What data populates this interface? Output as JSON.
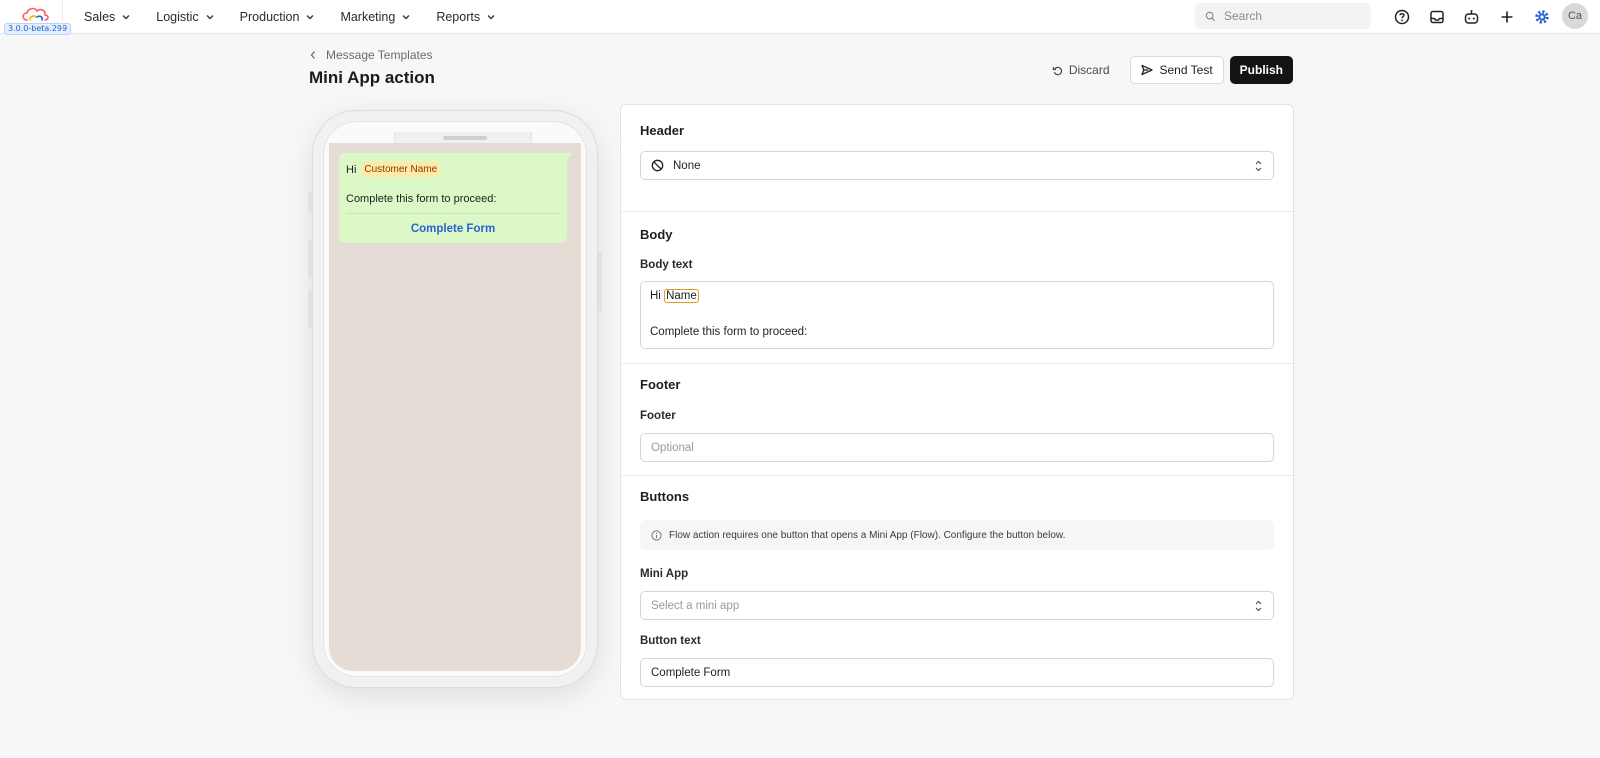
{
  "app": {
    "version": "3.0.0-beta.299",
    "brand_colors": [
      "#ff5a5f",
      "#ffb400",
      "#2a62d6"
    ]
  },
  "nav": {
    "items": [
      {
        "label": "Sales"
      },
      {
        "label": "Logistic"
      },
      {
        "label": "Production"
      },
      {
        "label": "Marketing"
      },
      {
        "label": "Reports"
      }
    ]
  },
  "search": {
    "placeholder": "Search"
  },
  "top_icons": [
    "help-icon",
    "inbox-icon",
    "bot-icon",
    "plus-icon",
    "settings-icon"
  ],
  "user": {
    "initials": "Ca"
  },
  "breadcrumb": {
    "back_label": "Message Templates"
  },
  "page": {
    "title": "Mini App action"
  },
  "actions": {
    "discard": "Discard",
    "send_test": "Send Test",
    "publish": "Publish"
  },
  "preview": {
    "greeting": "Hi",
    "variable_chip": "Customer Name",
    "body": "Complete this form to proceed:",
    "button_text": "Complete Form"
  },
  "form": {
    "header": {
      "title": "Header",
      "selected": "None"
    },
    "body": {
      "title": "Body",
      "label": "Body text",
      "greeting": "Hi",
      "variable": "Name",
      "line2": "Complete this form to proceed:"
    },
    "footer": {
      "title": "Footer",
      "label": "Footer",
      "placeholder": "Optional"
    },
    "buttons": {
      "title": "Buttons",
      "info": "Flow action requires one button that opens a Mini App (Flow). Configure the button below.",
      "mini_app_label": "Mini App",
      "mini_app_placeholder": "Select a mini app",
      "button_text_label": "Button text",
      "button_text_value": "Complete Form"
    }
  }
}
